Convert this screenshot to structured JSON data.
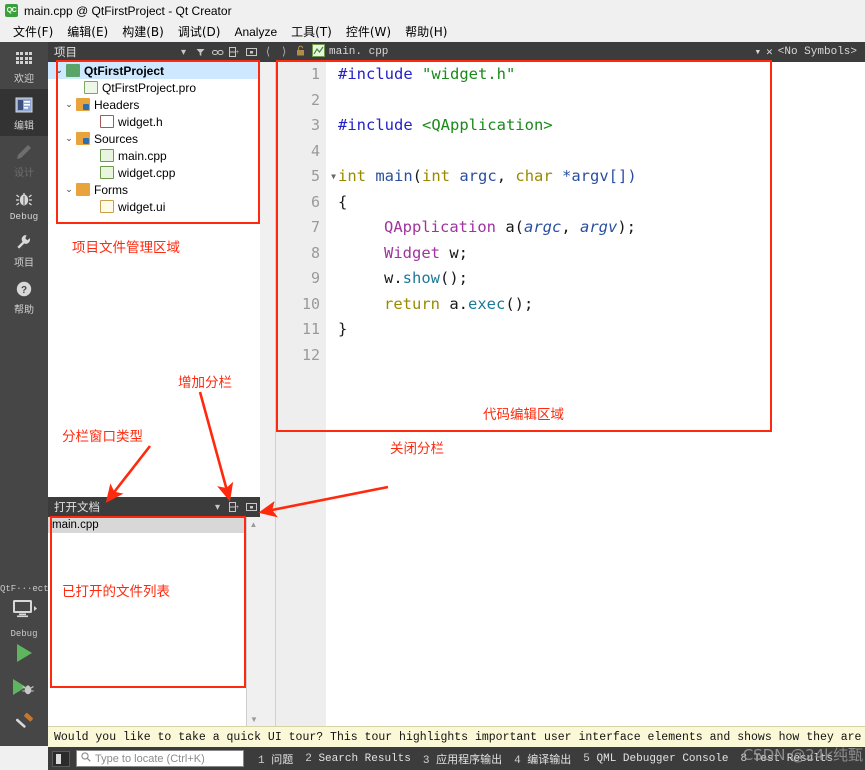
{
  "window": {
    "title": "main.cpp @ QtFirstProject - Qt Creator",
    "app_icon": "qt-creator-icon",
    "app_icon_text": "QC"
  },
  "menubar": {
    "items": [
      {
        "label": "文件(F)"
      },
      {
        "label": "编辑(E)"
      },
      {
        "label": "构建(B)"
      },
      {
        "label": "调试(D)"
      },
      {
        "label": "Analyze"
      },
      {
        "label": "工具(T)"
      },
      {
        "label": "控件(W)"
      },
      {
        "label": "帮助(H)"
      }
    ]
  },
  "activity_bar": {
    "modes": [
      {
        "label": "欢迎",
        "icon": "grid-icon",
        "state": "normal"
      },
      {
        "label": "编辑",
        "icon": "edit-icon",
        "state": "active"
      },
      {
        "label": "设计",
        "icon": "pencil-icon",
        "state": "disabled"
      },
      {
        "label": "Debug",
        "icon": "bug-icon",
        "state": "normal"
      },
      {
        "label": "项目",
        "icon": "wrench-icon",
        "state": "normal"
      },
      {
        "label": "帮助",
        "icon": "question-icon",
        "state": "normal"
      }
    ],
    "kit": {
      "project_label": "QtF···ect",
      "target_icon": "monitor-icon",
      "build_config": "Debug",
      "run_icon": "run-play-icon",
      "debug_icon": "debug-play-icon",
      "build_icon": "hammer-icon"
    }
  },
  "project_panel": {
    "title": "项目",
    "toolbar_icons": [
      "chevron-down-icon",
      "filter-icon",
      "link-icon",
      "split-add-icon",
      "close-split-icon"
    ],
    "tree": [
      {
        "label": "QtFirstProject",
        "indent": 0,
        "twisty": "⌄",
        "icon": "project-icon",
        "selected": true
      },
      {
        "label": "QtFirstProject.pro",
        "indent": 1,
        "twisty": "",
        "icon": "pro-file-icon",
        "selected": false
      },
      {
        "label": "Headers",
        "indent": 1,
        "twisty": "⌄",
        "icon": "folder-headers-icon",
        "selected": false
      },
      {
        "label": "widget.h",
        "indent": 2,
        "twisty": "",
        "icon": "header-file-icon",
        "selected": false
      },
      {
        "label": "Sources",
        "indent": 1,
        "twisty": "⌄",
        "icon": "folder-sources-icon",
        "selected": false
      },
      {
        "label": "main.cpp",
        "indent": 2,
        "twisty": "",
        "icon": "cpp-file-icon",
        "selected": false
      },
      {
        "label": "widget.cpp",
        "indent": 2,
        "twisty": "",
        "icon": "cpp-file-icon",
        "selected": false
      },
      {
        "label": "Forms",
        "indent": 1,
        "twisty": "⌄",
        "icon": "folder-forms-icon",
        "selected": false
      },
      {
        "label": "widget.ui",
        "indent": 2,
        "twisty": "",
        "icon": "ui-file-icon",
        "selected": false
      }
    ]
  },
  "open_documents": {
    "title": "打开文档",
    "toolbar_icons": [
      "chevron-down-icon",
      "split-add-icon",
      "close-split-icon"
    ],
    "documents": [
      {
        "label": "main.cpp",
        "selected": true
      }
    ]
  },
  "editor": {
    "toolbar": {
      "back_icon": "back-arrow-icon",
      "forward_icon": "forward-arrow-icon",
      "lock_icon": "unlock-icon",
      "file_icon": "cpp-file-icon",
      "filename": "main. cpp",
      "symbol_dropdown_icon": "chevron-down-icon",
      "close_icon": "close-icon",
      "symbols_label": "<No Symbols>"
    },
    "lines": [
      {
        "n": "1",
        "fold": false
      },
      {
        "n": "2",
        "fold": false
      },
      {
        "n": "3",
        "fold": false
      },
      {
        "n": "4",
        "fold": false
      },
      {
        "n": "5",
        "fold": true
      },
      {
        "n": "6",
        "fold": false
      },
      {
        "n": "7",
        "fold": false
      },
      {
        "n": "8",
        "fold": false
      },
      {
        "n": "9",
        "fold": false
      },
      {
        "n": "10",
        "fold": false
      },
      {
        "n": "11",
        "fold": false
      },
      {
        "n": "12",
        "fold": false
      }
    ],
    "code": {
      "l1_pre": "#include",
      "l1_str": " \"widget.h\"",
      "l3_pre": "#include",
      "l3_str": " <QApplication>",
      "l5_int": "int",
      "l5_main": " main",
      "l5_p1": "(",
      "l5_int2": "int",
      "l5_argc": " argc",
      "l5_comma": ", ",
      "l5_char": "char",
      "l5_argv": " *argv[])",
      "l6_brace": "{",
      "l7_cls": "QApplication",
      "l7_a": " a",
      "l7_open": "(",
      "l7_argc": "argc",
      "l7_comma": ", ",
      "l7_argv": "argv",
      "l7_close": ");",
      "l8_cls": "Widget",
      "l8_w": " w;",
      "l9_w": "w.",
      "l9_show": "show",
      "l9_tail": "();",
      "l10_ret": "return",
      "l10_a": " a.",
      "l10_exec": "exec",
      "l10_tail": "();",
      "l11_brace": "}"
    }
  },
  "annotations": [
    {
      "id": "project-area",
      "text": "项目文件管理区域"
    },
    {
      "id": "code-area",
      "text": "代码编辑区域"
    },
    {
      "id": "add-split",
      "text": "增加分栏"
    },
    {
      "id": "close-split",
      "text": "关闭分栏"
    },
    {
      "id": "split-type",
      "text": "分栏窗口类型"
    },
    {
      "id": "opened-files",
      "text": "已打开的文件列表"
    }
  ],
  "annotation_color": "#ff2a0e",
  "tour_bar": {
    "message": "Would you like to take a quick UI tour? This tour highlights important user interface elements and shows how they are used. To take the"
  },
  "statusbar": {
    "sidebar_toggle_icon": "sidebar-toggle-icon",
    "locator_icon": "search-icon",
    "locator_placeholder": "Type to locate (Ctrl+K)",
    "panes": [
      {
        "num": "1",
        "label": "问题"
      },
      {
        "num": "2",
        "label": "Search Results"
      },
      {
        "num": "3",
        "label": "应用程序输出"
      },
      {
        "num": "4",
        "label": "编译输出"
      },
      {
        "num": "5",
        "label": "QML Debugger Console"
      },
      {
        "num": "8",
        "label": "Test Results"
      }
    ],
    "watermark": "CSDN @24k纯甄"
  }
}
